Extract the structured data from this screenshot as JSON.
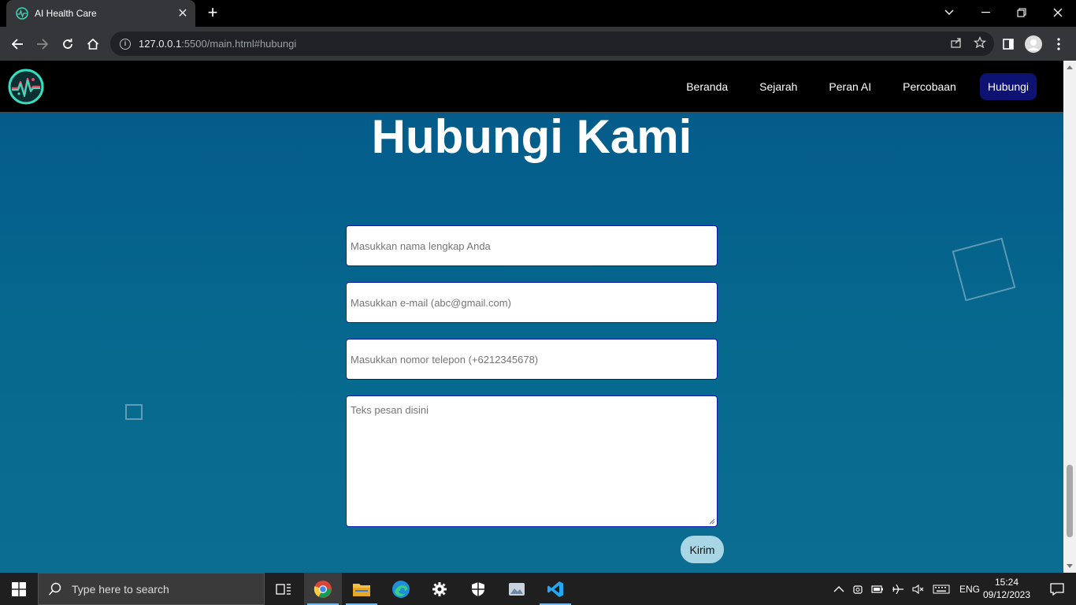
{
  "browser": {
    "tab_title": "AI Health Care",
    "url_host": "127.0.0.1",
    "url_rest": ":5500/main.html#hubungi"
  },
  "nav": {
    "items": [
      {
        "label": "Beranda"
      },
      {
        "label": "Sejarah"
      },
      {
        "label": "Peran AI"
      },
      {
        "label": "Percobaan"
      },
      {
        "label": "Hubungi"
      }
    ],
    "active_color": "#0d1273"
  },
  "contact": {
    "heading": "Hubungi Kami",
    "name_placeholder": "Masukkan nama lengkap Anda",
    "email_placeholder": "Masukkan e-mail (abc@gmail.com)",
    "phone_placeholder": "Masukkan nomor telepon (+6212345678)",
    "message_placeholder": "Teks pesan disini",
    "submit_label": "Kirim"
  },
  "taskbar": {
    "search_placeholder": "Type here to search",
    "language": "ENG",
    "time": "15:24",
    "date": "09/12/2023"
  },
  "colors": {
    "page_top": "#04598a",
    "page_bottom": "#0b6d91",
    "submit_bg": "#a9d6e5",
    "field_border": "#0a1aa8"
  }
}
